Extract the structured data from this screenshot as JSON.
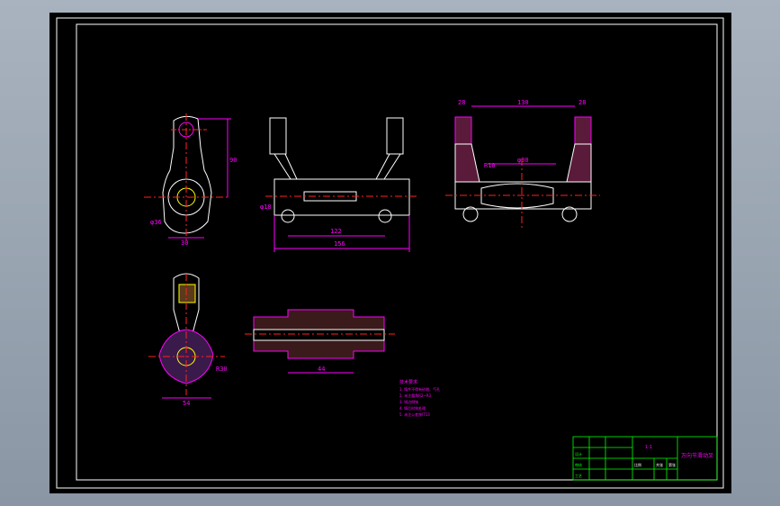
{
  "colors": {
    "sheet": "#000000",
    "frame": "#ffffff",
    "part": "#ffffff",
    "dimension": "#ff00ff",
    "centerline": "#ff2020",
    "title_block": "#00ff00",
    "title_text": "#ff00ff",
    "note_text": "#ff00ff"
  },
  "dimensions": {
    "front_view": {
      "inner_span": "122",
      "overall_width": "156",
      "pin_dia": "φ18"
    },
    "top_view": {
      "inner_span": "130",
      "left_lug": "28",
      "right_lug": "28",
      "neck": "φ30",
      "fillet": "R10"
    },
    "side_view": {
      "width": "30",
      "height": "90",
      "hub": "φ36"
    },
    "section_view": {
      "width": "54",
      "hub": "R30"
    },
    "shaft_view": {
      "length": "44"
    }
  },
  "notes": {
    "title": "技术要求",
    "lines": [
      "1. 铸件不得有砂眼、气孔",
      "2. 未注圆角R2~R3",
      "3. 锐边倒钝",
      "4. 铸后时效处理",
      "5. 未注公差按IT13"
    ]
  },
  "title_block": {
    "scale": "1:1",
    "drawing_name": "万向节滑动叉",
    "cells": [
      "设计",
      "审核",
      "工艺",
      "比例",
      "共张",
      "第张"
    ]
  }
}
